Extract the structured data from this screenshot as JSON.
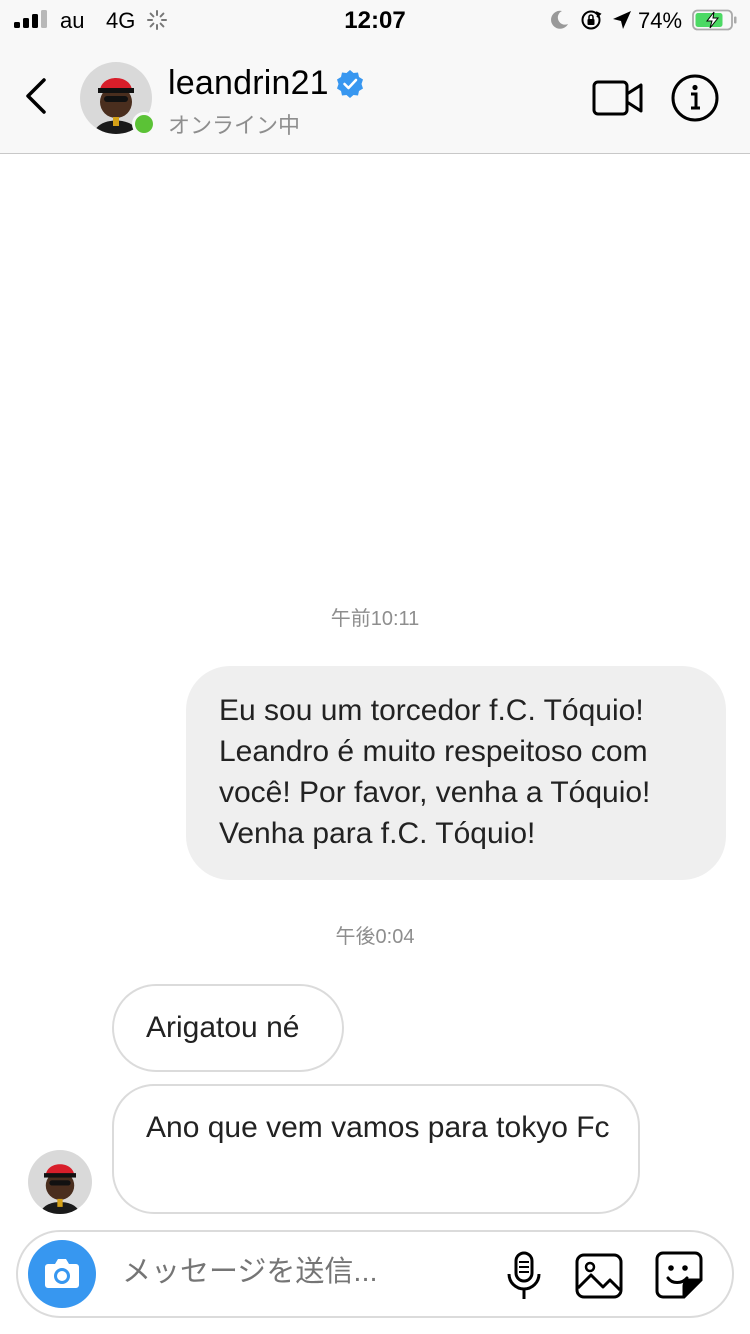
{
  "status_bar": {
    "carrier": "au",
    "network": "4G",
    "time": "12:07",
    "battery_percent": "74%",
    "icons": [
      "signal-icon",
      "loading-icon",
      "moon-icon",
      "orientation-lock-icon",
      "location-icon",
      "battery-charging-icon"
    ]
  },
  "header": {
    "username": "leandrin21",
    "verified": true,
    "presence": "オンライン中",
    "icons": [
      "back-icon",
      "video-call-icon",
      "info-icon"
    ]
  },
  "messages": [
    {
      "type": "timestamp",
      "text": "午前10:11"
    },
    {
      "type": "sent",
      "text": "Eu sou um torcedor f.C. Tóquio!\nLeandro é muito respeitoso com você! Por favor, venha a Tóquio!\nVenha para f.C. Tóquio!"
    },
    {
      "type": "timestamp",
      "text": "午後0:04"
    },
    {
      "type": "received",
      "text": "Arigatou né"
    },
    {
      "type": "received",
      "text": "Ano que vem vamos para tokyo Fc"
    }
  ],
  "composer": {
    "placeholder": "メッセージを送信...",
    "icons": [
      "camera-icon",
      "microphone-icon",
      "gallery-icon",
      "sticker-icon"
    ]
  },
  "colors": {
    "accent": "#3797f0",
    "online": "#5bc236",
    "verified": "#3897f0",
    "sent_bubble": "#efefef",
    "battery": "#4cd964"
  }
}
